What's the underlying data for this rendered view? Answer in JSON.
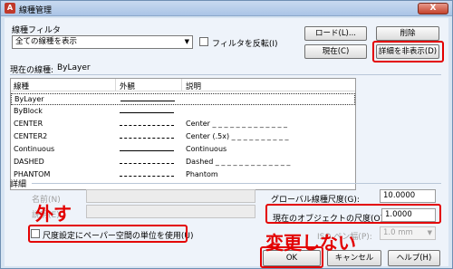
{
  "window": {
    "title": "線種管理",
    "close_glyph": "X"
  },
  "filter": {
    "label": "線種フィルタ",
    "selected": "全ての線種を表示",
    "invert_label": "フィルタを反転(I)"
  },
  "buttons": {
    "load": "ロード(L)...",
    "delete": "削除",
    "current": "現在(C)",
    "hide_details": "詳細を非表示(D)",
    "ok": "OK",
    "cancel": "キャンセル",
    "help": "ヘルプ(H)"
  },
  "current_linetype": {
    "label": "現在の線種:",
    "value": "ByLayer"
  },
  "table": {
    "headers": [
      "線種",
      "外観",
      "説明"
    ],
    "rows": [
      {
        "name": "ByLayer",
        "desc": "",
        "selected": true
      },
      {
        "name": "ByBlock",
        "desc": "",
        "selected": false
      },
      {
        "name": "CENTER",
        "desc": "Center _ _ _ _ _ _ _ _ _ _ _ _ _",
        "selected": false
      },
      {
        "name": "CENTER2",
        "desc": "Center (.5x) _ _ _ _ _ _ _ _ _ _",
        "selected": false
      },
      {
        "name": "Continuous",
        "desc": "Continuous",
        "selected": false
      },
      {
        "name": "DASHED",
        "desc": "Dashed _ _ _ _ _ _ _ _ _ _ _ _ _",
        "selected": false
      },
      {
        "name": "PHANTOM",
        "desc": "Phantom",
        "selected": false
      }
    ]
  },
  "details": {
    "label": "詳細",
    "name_label": "名前(N)",
    "desc_label": "説明(E)",
    "paper_space_label": "尺度設定にペーパー空間の単位を使用(U)",
    "global_scale_label": "グローバル線種尺度(G):",
    "global_scale_value": "10.0000",
    "current_scale_label": "現在のオブジェクトの尺度(O):",
    "current_scale_value": "1.0000",
    "pen_width_label": "ISO ペン幅(P):",
    "pen_width_value": "1.0 mm"
  },
  "annotations": {
    "remove": "外す",
    "dont_change": "変更しない"
  }
}
